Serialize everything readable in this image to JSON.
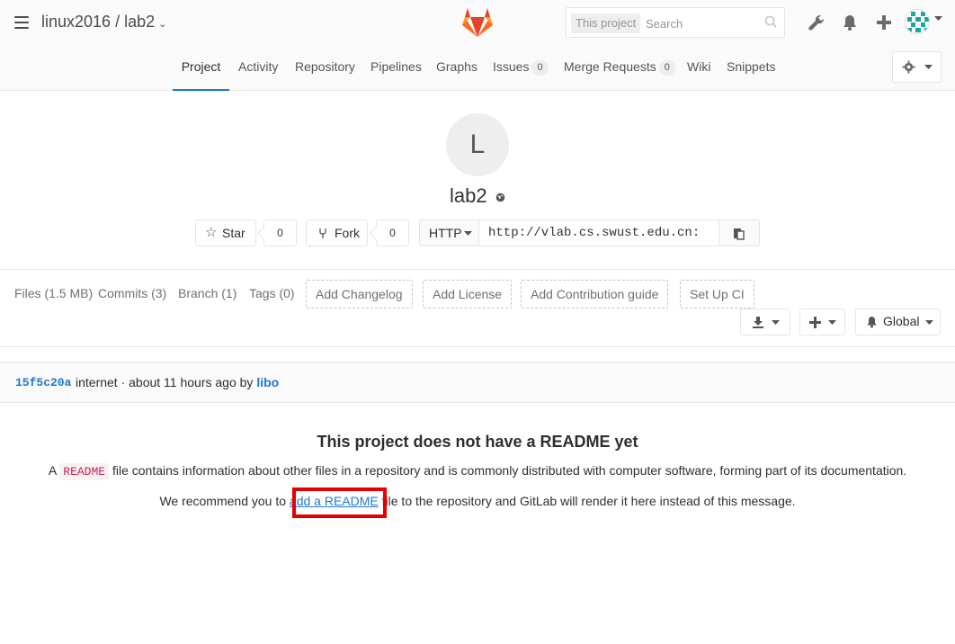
{
  "header": {
    "project_path": "linux2016 / lab2",
    "search": {
      "scope": "This project",
      "placeholder": "Search"
    }
  },
  "nav": {
    "tabs": [
      {
        "label": "Project"
      },
      {
        "label": "Activity"
      },
      {
        "label": "Repository"
      },
      {
        "label": "Pipelines"
      },
      {
        "label": "Graphs"
      },
      {
        "label": "Issues",
        "count": "0"
      },
      {
        "label": "Merge Requests",
        "count": "0"
      },
      {
        "label": "Wiki"
      },
      {
        "label": "Snippets"
      }
    ]
  },
  "project": {
    "avatar_letter": "L",
    "name": "lab2",
    "star_label": "Star",
    "star_count": "0",
    "fork_label": "Fork",
    "fork_count": "0",
    "protocol": "HTTP",
    "clone_url": "http://vlab.cs.swust.edu.cn:"
  },
  "stats": {
    "files": "Files (1.5 MB)",
    "commits": "Commits (3)",
    "branch": "Branch (1)",
    "tags": "Tags (0)",
    "add_changelog": "Add Changelog",
    "add_license": "Add License",
    "add_contribution": "Add Contribution guide",
    "setup_ci": "Set Up CI",
    "notification": "Global"
  },
  "commit": {
    "sha": "15f5c20a",
    "message": "internet · about 11 hours ago by",
    "author": "libo"
  },
  "readme": {
    "title": "This project does not have a README yet",
    "desc_prefix": "A",
    "code": "README",
    "desc_suffix": "file contains information about other files in a repository and is commonly distributed with computer software, forming part of its documentation.",
    "rec_prefix": "We recommend you to",
    "rec_link": "add a README",
    "rec_suffix": "file to the repository and GitLab will render it here instead of this message."
  },
  "colors": {
    "accent": "#1f78d1",
    "highlight": "#e60000"
  }
}
